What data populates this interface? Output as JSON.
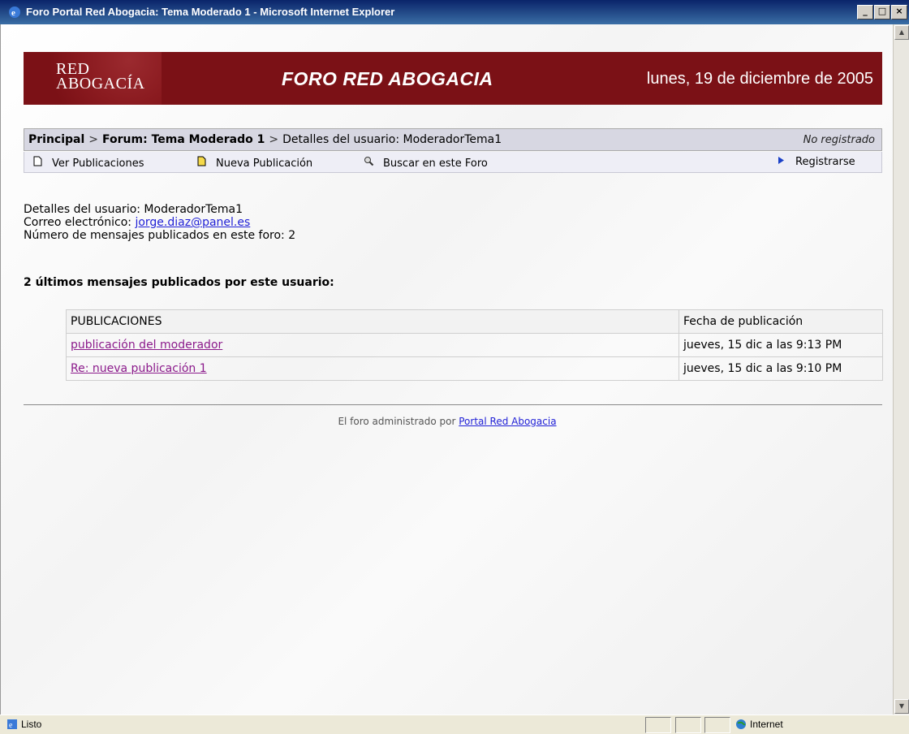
{
  "window": {
    "title": "Foro Portal Red Abogacia: Tema Moderado 1 - Microsoft Internet Explorer",
    "minimize": "_",
    "maximize": "□",
    "close": "×"
  },
  "banner": {
    "logo_line1": "RED",
    "logo_line2": "ABOGACÍA",
    "title": "FORO RED ABOGACIA",
    "date": "lunes, 19 de diciembre de 2005",
    "color": "#7b1116"
  },
  "breadcrumb": {
    "home": "Principal",
    "sep": ">",
    "forum": "Forum: Tema Moderado 1",
    "current": "Detalles del usuario: ModeradorTema1",
    "status": "No registrado"
  },
  "toolbar": {
    "view_posts": "Ver Publicaciones",
    "new_post": "Nueva Publicación",
    "search_forum": "Buscar en este Foro",
    "register": "Registrarse",
    "icons": [
      "page-icon",
      "new-page-icon",
      "search-icon",
      "triangle-right-icon"
    ]
  },
  "user": {
    "details_label": "Detalles del usuario: ModeradorTema1",
    "email_label": "Correo electrónico:",
    "email": "jorge.diaz@panel.es",
    "count_label": "Número de mensajes publicados en este foro: 2"
  },
  "recent": {
    "heading": "2 últimos mensajes publicados por este usuario:",
    "col_posts": "PUBLICACIONES",
    "col_date": "Fecha de publicación",
    "rows": [
      {
        "title": "publicación del moderador",
        "date": "jueves, 15 dic a las 9:13 PM"
      },
      {
        "title": "Re: nueva publicación 1",
        "date": "jueves, 15 dic a las 9:10 PM"
      }
    ]
  },
  "footer": {
    "text": "El foro administrado por",
    "link": "Portal Red Abogacia"
  },
  "statusbar": {
    "status": "Listo",
    "zone": "Internet"
  }
}
